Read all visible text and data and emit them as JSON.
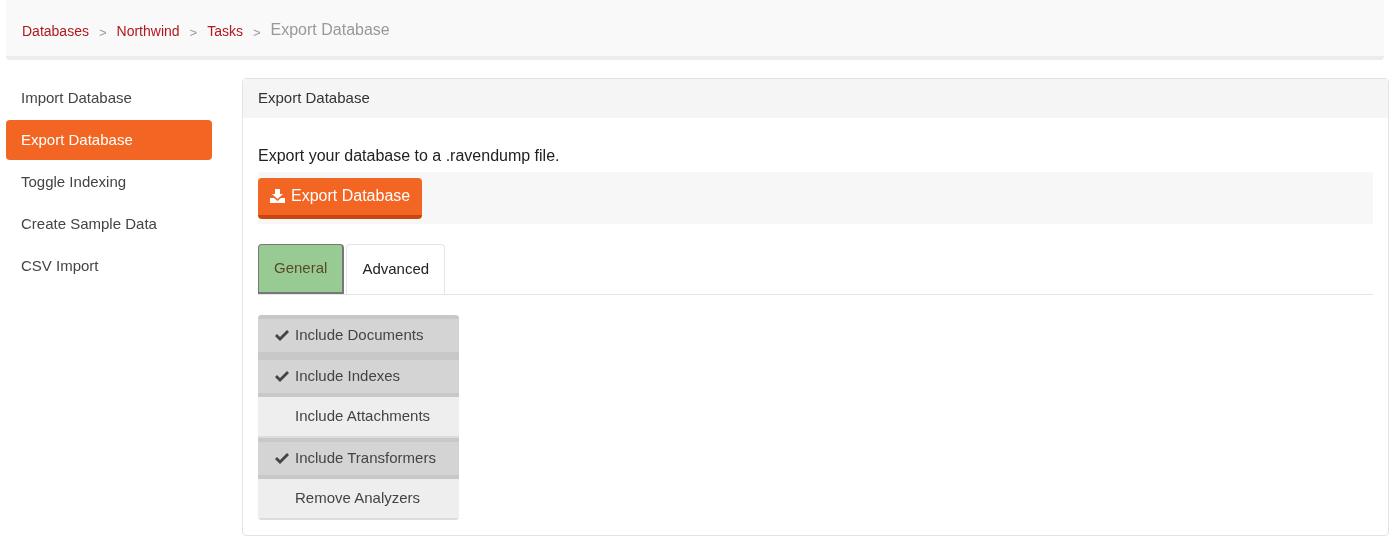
{
  "breadcrumb": [
    {
      "label": "Databases",
      "kind": "link",
      "separator": ">"
    },
    {
      "label": "Northwind",
      "kind": "link",
      "separator": ">"
    },
    {
      "label": "Tasks",
      "kind": "link",
      "separator": ">"
    },
    {
      "label": "Export Database",
      "kind": "current"
    }
  ],
  "sidebar": {
    "items": [
      {
        "label": "Import Database",
        "selected": false
      },
      {
        "label": "Export Database",
        "selected": true
      },
      {
        "label": "Toggle Indexing",
        "selected": false
      },
      {
        "label": "Create Sample Data",
        "selected": false
      },
      {
        "label": "CSV Import",
        "selected": false
      }
    ]
  },
  "panel": {
    "title": "Export Database",
    "description": "Export your database to a .ravendump file.",
    "export_button": "Export Database",
    "tabs": [
      {
        "label": "General",
        "selected": true
      },
      {
        "label": "Advanced",
        "selected": false
      }
    ],
    "options": [
      {
        "label": "Include Documents",
        "checked": true
      },
      {
        "label": "Include Indexes",
        "checked": true
      },
      {
        "label": "Include Attachments",
        "checked": false
      },
      {
        "label": "Include Transformers",
        "checked": true
      },
      {
        "label": "Remove Analyzers",
        "checked": false
      }
    ]
  }
}
